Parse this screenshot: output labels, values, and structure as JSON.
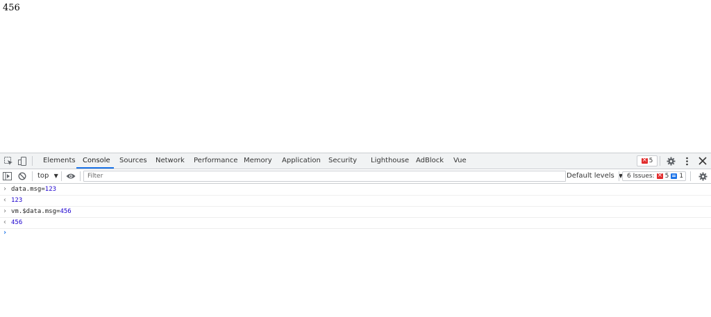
{
  "page": {
    "text": "456"
  },
  "devtools": {
    "tabs": [
      {
        "label": "Elements"
      },
      {
        "label": "Console"
      },
      {
        "label": "Sources"
      },
      {
        "label": "Network"
      },
      {
        "label": "Performance"
      },
      {
        "label": "Memory"
      },
      {
        "label": "Application"
      },
      {
        "label": "Security"
      },
      {
        "label": "Lighthouse"
      },
      {
        "label": "AdBlock"
      },
      {
        "label": "Vue"
      }
    ],
    "active_tab": "Console",
    "error_count": "5",
    "toolbar": {
      "context": "top",
      "filter_placeholder": "Filter",
      "levels": "Default levels",
      "issues_label": "6 Issues:",
      "issues_errors": "5",
      "issues_info": "1"
    },
    "console": {
      "entries": [
        {
          "type": "input",
          "code": "data.msg",
          "eq": "=",
          "value": "123"
        },
        {
          "type": "result",
          "value": "123"
        },
        {
          "type": "input",
          "code": "vm.$data.msg",
          "eq": "=",
          "value": "456"
        },
        {
          "type": "result",
          "value": "456"
        }
      ]
    },
    "colors": {
      "accent": "#1a73e8",
      "error": "#e22d2d",
      "number": "#1c00cf"
    }
  }
}
